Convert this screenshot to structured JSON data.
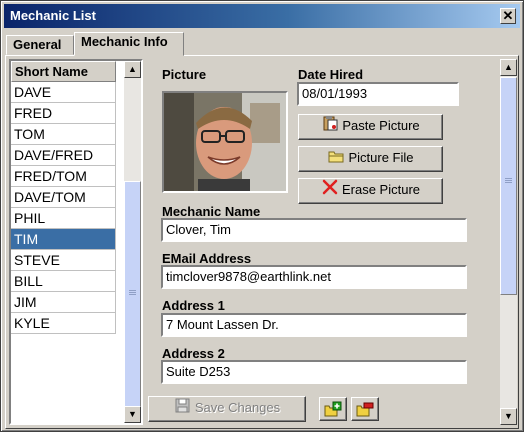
{
  "window": {
    "title": "Mechanic List",
    "close_glyph": "✕"
  },
  "tabs": [
    {
      "label": "General"
    },
    {
      "label": "Mechanic Info"
    }
  ],
  "mechanic_list": {
    "header": "Short Name",
    "items": [
      "DAVE",
      "FRED",
      "TOM",
      "DAVE/FRED",
      "FRED/TOM",
      "DAVE/TOM",
      "PHIL",
      "TIM",
      "STEVE",
      "BILL",
      "JIM",
      "KYLE"
    ],
    "selected": "TIM"
  },
  "form": {
    "picture_label": "Picture",
    "date_hired_label": "Date Hired",
    "date_hired_value": "08/01/1993",
    "mechanic_name_label": "Mechanic Name",
    "mechanic_name_value": "Clover, Tim",
    "email_label": "EMail Address",
    "email_value": "timclover9878@earthlink.net",
    "address1_label": "Address 1",
    "address1_value": "7 Mount Lassen Dr.",
    "address2_label": "Address 2",
    "address2_value": "Suite D253"
  },
  "buttons": {
    "paste_picture": "Paste Picture",
    "picture_file": "Picture File",
    "erase_picture": "Erase Picture",
    "save_changes": "Save Changes"
  },
  "scroll": {
    "up_glyph": "▲",
    "down_glyph": "▼"
  },
  "icons": {
    "paste": "paste-icon",
    "folder": "folder-icon",
    "erase": "erase-x-icon",
    "save": "floppy-disk-icon",
    "add": "add-record-icon",
    "delete": "delete-record-icon"
  }
}
